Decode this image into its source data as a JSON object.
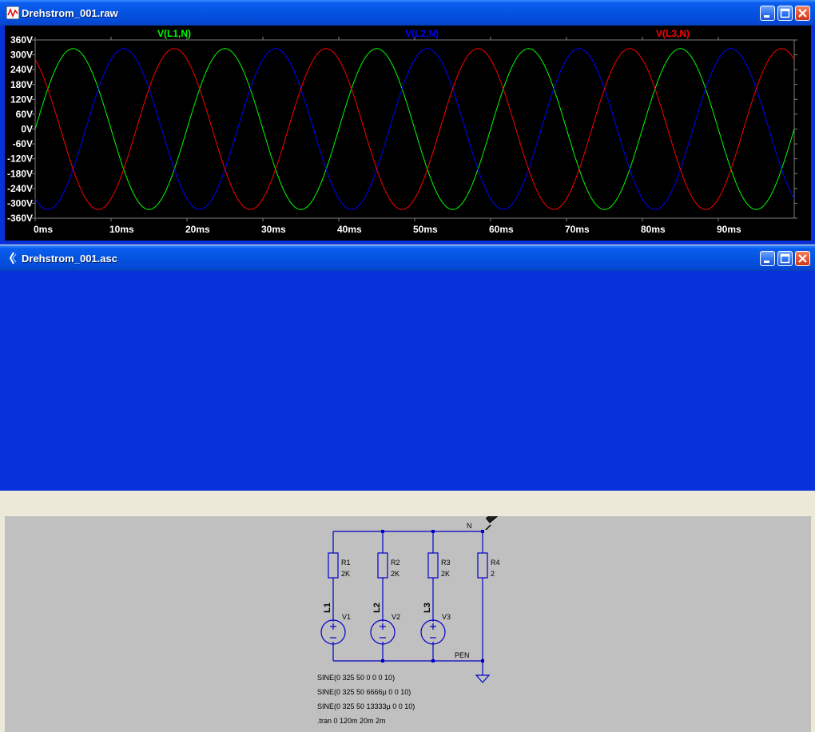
{
  "waveform_window": {
    "title": "Drehstrom_001.raw",
    "icon": "waveform-viewer-icon",
    "buttons": [
      "minimize-icon",
      "maximize-icon",
      "close-icon"
    ]
  },
  "schematic_window": {
    "title": "Drehstrom_001.asc",
    "icon": "schematic-editor-icon",
    "buttons": [
      "minimize-icon",
      "maximize-icon",
      "close-icon"
    ]
  },
  "chart_data": {
    "type": "line",
    "title": "",
    "xlabel": "",
    "ylabel": "",
    "xlim": [
      0,
      100
    ],
    "ylim": [
      -360,
      360
    ],
    "x_ticks": [
      "0ms",
      "10ms",
      "20ms",
      "30ms",
      "40ms",
      "50ms",
      "60ms",
      "70ms",
      "80ms",
      "90ms"
    ],
    "y_ticks": [
      "360V",
      "300V",
      "240V",
      "180V",
      "120V",
      "60V",
      "0V",
      "-60V",
      "-120V",
      "-180V",
      "-240V",
      "-300V",
      "-360V"
    ],
    "grid": false,
    "legend": "top",
    "series": [
      {
        "name": "V(L1,N)",
        "color": "#00ff00",
        "amplitude": 325,
        "frequency_hz": 50,
        "phase_deg": 0
      },
      {
        "name": "V(L2,N)",
        "color": "#0000ff",
        "amplitude": 325,
        "frequency_hz": 50,
        "phase_deg": -120
      },
      {
        "name": "V(L3,N)",
        "color": "#ff0000",
        "amplitude": 325,
        "frequency_hz": 50,
        "phase_deg": 120
      }
    ]
  },
  "schematic": {
    "resistors": [
      {
        "name": "R1",
        "value": "2K"
      },
      {
        "name": "R2",
        "value": "2K"
      },
      {
        "name": "R3",
        "value": "2K"
      },
      {
        "name": "R4",
        "value": "2"
      }
    ],
    "sources": [
      {
        "name": "V1",
        "net": "L1"
      },
      {
        "name": "V2",
        "net": "L2"
      },
      {
        "name": "V3",
        "net": "L3"
      }
    ],
    "net_labels": {
      "top": "N",
      "bottom": "PEN"
    },
    "directives": [
      "SINE(0 325 50 0 0 0 10)",
      "SINE(0 325 50 6666µ 0 0 10)",
      "SINE(0 325 50 13333µ 0 0 10)",
      ".tran 0 120m 20m 2m"
    ],
    "wire_color": "#0000c8",
    "probe_icon": "voltage-probe-icon"
  }
}
